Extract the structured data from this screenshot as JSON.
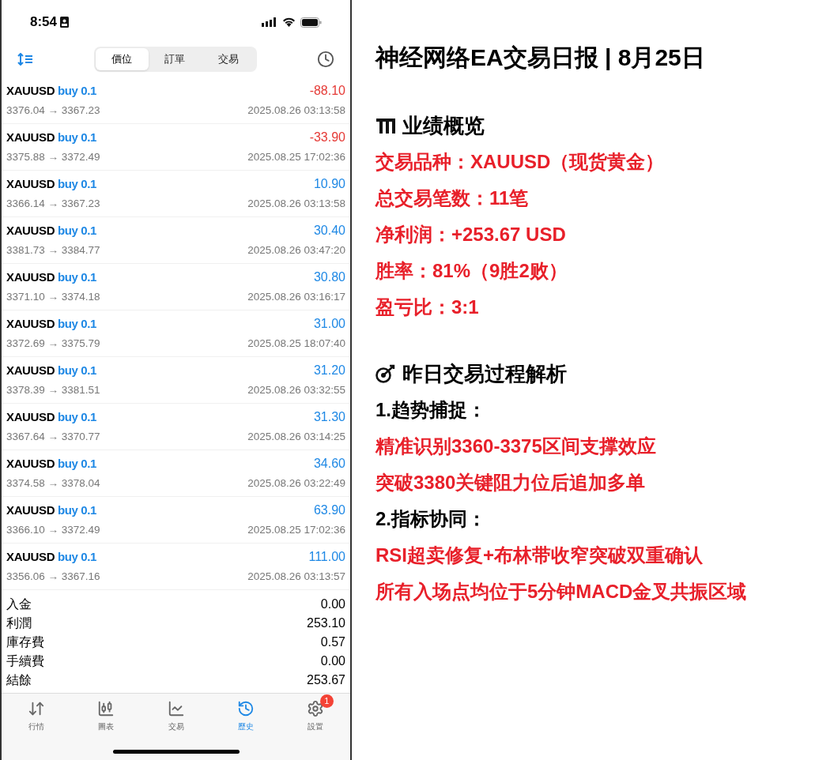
{
  "status_bar": {
    "time": "8:54"
  },
  "toolbar": {
    "segments": [
      {
        "label": "價位",
        "selected": true
      },
      {
        "label": "訂單",
        "selected": false
      },
      {
        "label": "交易",
        "selected": false
      }
    ]
  },
  "trades": [
    {
      "symbol": "XAUUSD",
      "side": "buy 0.1",
      "profit": "-88.10",
      "color": "#e53935",
      "prices": "3376.04 → 3367.23",
      "time": "2025.08.26 03:13:58"
    },
    {
      "symbol": "XAUUSD",
      "side": "buy 0.1",
      "profit": "-33.90",
      "color": "#e53935",
      "prices": "3375.88 → 3372.49",
      "time": "2025.08.25 17:02:36"
    },
    {
      "symbol": "XAUUSD",
      "side": "buy 0.1",
      "profit": "10.90",
      "color": "#1e88e5",
      "prices": "3366.14 → 3367.23",
      "time": "2025.08.26 03:13:58"
    },
    {
      "symbol": "XAUUSD",
      "side": "buy 0.1",
      "profit": "30.40",
      "color": "#1e88e5",
      "prices": "3381.73 → 3384.77",
      "time": "2025.08.26 03:47:20"
    },
    {
      "symbol": "XAUUSD",
      "side": "buy 0.1",
      "profit": "30.80",
      "color": "#1e88e5",
      "prices": "3371.10 → 3374.18",
      "time": "2025.08.26 03:16:17"
    },
    {
      "symbol": "XAUUSD",
      "side": "buy 0.1",
      "profit": "31.00",
      "color": "#1e88e5",
      "prices": "3372.69 → 3375.79",
      "time": "2025.08.25 18:07:40"
    },
    {
      "symbol": "XAUUSD",
      "side": "buy 0.1",
      "profit": "31.20",
      "color": "#1e88e5",
      "prices": "3378.39 → 3381.51",
      "time": "2025.08.26 03:32:55"
    },
    {
      "symbol": "XAUUSD",
      "side": "buy 0.1",
      "profit": "31.30",
      "color": "#1e88e5",
      "prices": "3367.64 → 3370.77",
      "time": "2025.08.26 03:14:25"
    },
    {
      "symbol": "XAUUSD",
      "side": "buy 0.1",
      "profit": "34.60",
      "color": "#1e88e5",
      "prices": "3374.58 → 3378.04",
      "time": "2025.08.26 03:22:49"
    },
    {
      "symbol": "XAUUSD",
      "side": "buy 0.1",
      "profit": "63.90",
      "color": "#1e88e5",
      "prices": "3366.10 → 3372.49",
      "time": "2025.08.25 17:02:36"
    },
    {
      "symbol": "XAUUSD",
      "side": "buy 0.1",
      "profit": "111.00",
      "color": "#1e88e5",
      "prices": "3356.06 → 3367.16",
      "time": "2025.08.26 03:13:57"
    }
  ],
  "summary": [
    {
      "label": "入金",
      "value": "0.00"
    },
    {
      "label": "利潤",
      "value": "253.10"
    },
    {
      "label": "庫存費",
      "value": "0.57"
    },
    {
      "label": "手續費",
      "value": "0.00"
    },
    {
      "label": "結餘",
      "value": "253.67"
    }
  ],
  "tab_bar": [
    {
      "label": "行情",
      "selected": false
    },
    {
      "label": "圖表",
      "selected": false
    },
    {
      "label": "交易",
      "selected": false
    },
    {
      "label": "歷史",
      "selected": true
    },
    {
      "label": "設置",
      "selected": false,
      "badge": "1"
    }
  ],
  "report": {
    "title": "神经网络EA交易日报 | 8月25日",
    "lines": [
      {
        "kind": "section",
        "text": "业绩概览"
      },
      {
        "kind": "highlight",
        "text": "交易品种：XAUUSD（现货黄金）"
      },
      {
        "kind": "highlight",
        "text": "总交易笔数：11笔"
      },
      {
        "kind": "highlight",
        "text": "净利润：+253.67 USD"
      },
      {
        "kind": "highlight",
        "text": "胜率：81%（9胜2败）"
      },
      {
        "kind": "highlight",
        "text": "盈亏比：3:1"
      },
      {
        "kind": "section",
        "text": "昨日交易过程解析"
      },
      {
        "kind": "subheading",
        "text": "1.趋势捕捉："
      },
      {
        "kind": "highlight",
        "text": "精准识别3360-3375区间支撑效应"
      },
      {
        "kind": "highlight",
        "text": "突破3380关键阻力位后追加多单"
      },
      {
        "kind": "subheading",
        "text": "2.指标协同："
      },
      {
        "kind": "highlight",
        "text": "RSI超卖修复+布林带收窄突破双重确认"
      },
      {
        "kind": "highlight",
        "text": "所有入场点均位于5分钟MACD金叉共振区域"
      }
    ]
  }
}
